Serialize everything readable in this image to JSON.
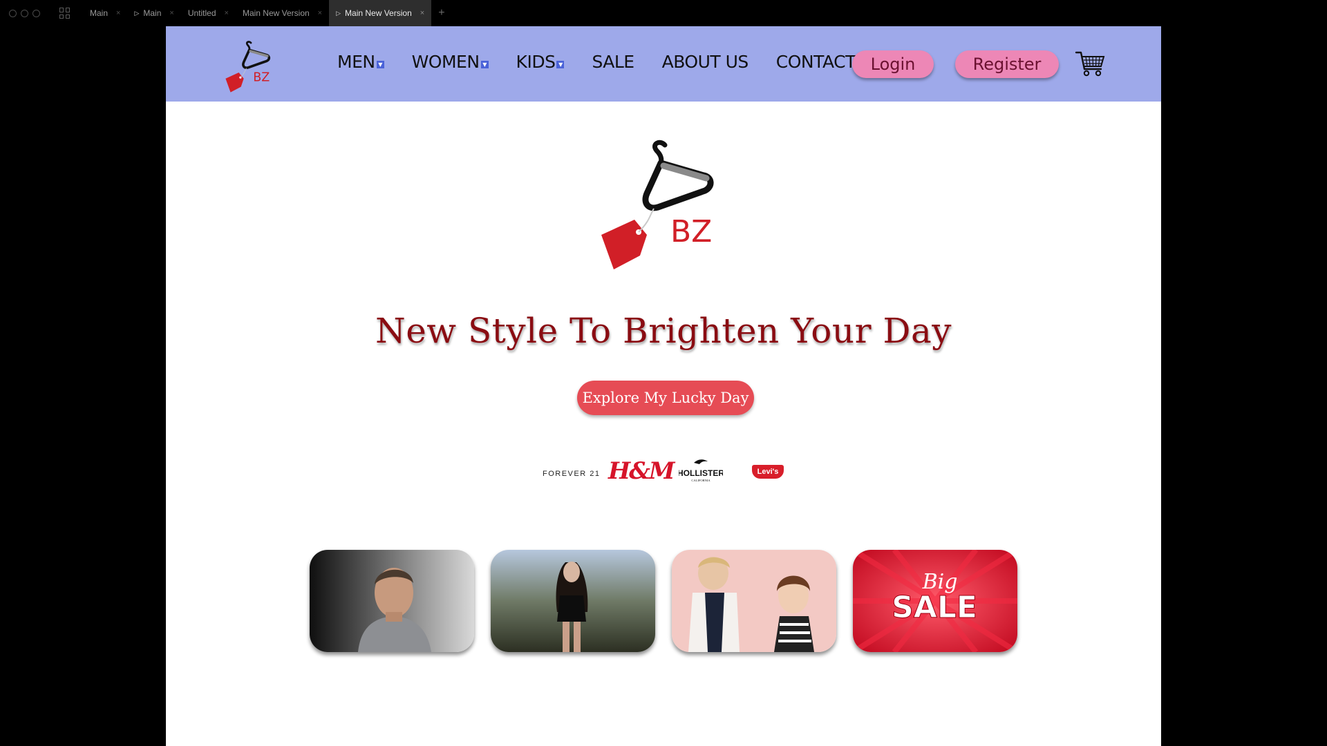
{
  "window": {
    "tabs": [
      {
        "label": "Main",
        "has_play": false,
        "active": false
      },
      {
        "label": "Main",
        "has_play": true,
        "active": false
      },
      {
        "label": "Untitled",
        "has_play": false,
        "active": false
      },
      {
        "label": "Main New Version",
        "has_play": false,
        "active": false
      },
      {
        "label": "Main New Version",
        "has_play": true,
        "active": true
      }
    ],
    "new_tab_symbol": "+"
  },
  "header": {
    "logo_text": "BZ",
    "nav": [
      {
        "label": "MEN",
        "dropdown": true
      },
      {
        "label": "WOMEN",
        "dropdown": true
      },
      {
        "label": "KIDS",
        "dropdown": true
      },
      {
        "label": "SALE",
        "dropdown": false
      },
      {
        "label": "ABOUT US",
        "dropdown": false
      },
      {
        "label": "CONTACT",
        "dropdown": false
      }
    ],
    "login_label": "Login",
    "register_label": "Register",
    "cart_icon": "shopping-cart-icon",
    "colors": {
      "bar": "#9ea9ea",
      "pill": "#ed87b6",
      "pill_text": "#6b1130"
    }
  },
  "hero": {
    "logo_text": "BZ",
    "headline": "New Style To Brighten Your Day",
    "cta_label": "Explore My Lucky Day",
    "colors": {
      "headline": "#8a0c12",
      "cta": "#e64c55"
    }
  },
  "brands": {
    "forever21": "FOREVER 21",
    "hm": "H&M",
    "hollister": "HOLLISTER",
    "hollister_sub": "CALIFORNIA",
    "levis": "Levi's"
  },
  "categories": [
    {
      "name": "men",
      "image": "man-portrait"
    },
    {
      "name": "women",
      "image": "woman-portrait"
    },
    {
      "name": "kids",
      "image": "kids-portrait"
    },
    {
      "name": "sale",
      "image": "big-sale-banner",
      "text_top": "Big",
      "text_bottom": "SALE"
    }
  ]
}
